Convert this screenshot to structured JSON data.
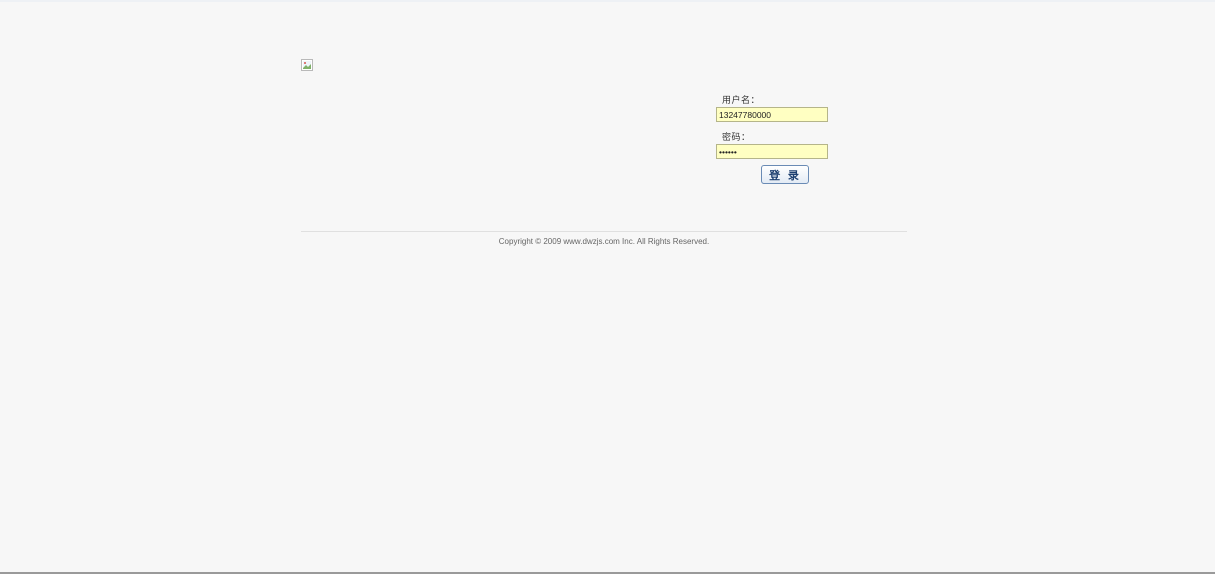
{
  "login": {
    "username_label": "用户名：",
    "username_value": "13247780000",
    "password_label": "密码：",
    "password_value": "••••••",
    "submit_label": "登 录"
  },
  "footer": {
    "copyright": "Copyright © 2009 www.dwzjs.com Inc. All Rights Reserved."
  },
  "icons": {
    "logo": "broken-image-icon"
  },
  "colors": {
    "page_background": "#f7f7f7",
    "input_background": "#ffffc2",
    "button_text": "#1d3f70"
  }
}
